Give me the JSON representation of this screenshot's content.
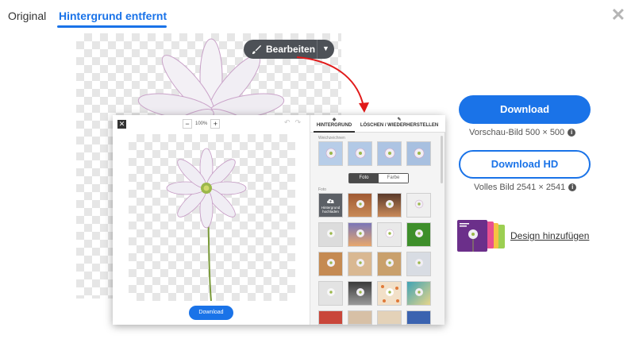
{
  "tabs": {
    "original": "Original",
    "removed": "Hintergrund entfernt"
  },
  "close_icon": "close-icon",
  "edit_pill": {
    "label": "Bearbeiten",
    "icon": "brush-icon"
  },
  "editor": {
    "zoom_value": "100%",
    "zoom_minus": "−",
    "zoom_plus": "+",
    "tab_background": "HINTERGRUND",
    "tab_erase_restore": "LÖSCHEN / WIEDERHERSTELLEN",
    "blur_label": "Weichzeichnen",
    "segment": {
      "photo": "Foto",
      "color": "Farbe"
    },
    "photo_label": "Foto",
    "upload_tile": "Hintergrund hochladen",
    "download_label": "Download"
  },
  "actions": {
    "download": "Download",
    "preview_note": "Vorschau-Bild 500 × 500",
    "download_hd": "Download HD",
    "full_note": "Volles Bild 2541 × 2541",
    "design_link": "Design hinzufügen"
  },
  "colors": {
    "accent": "#1a73e8",
    "pill": "#4d5157",
    "arrow": "#e11a1a"
  }
}
